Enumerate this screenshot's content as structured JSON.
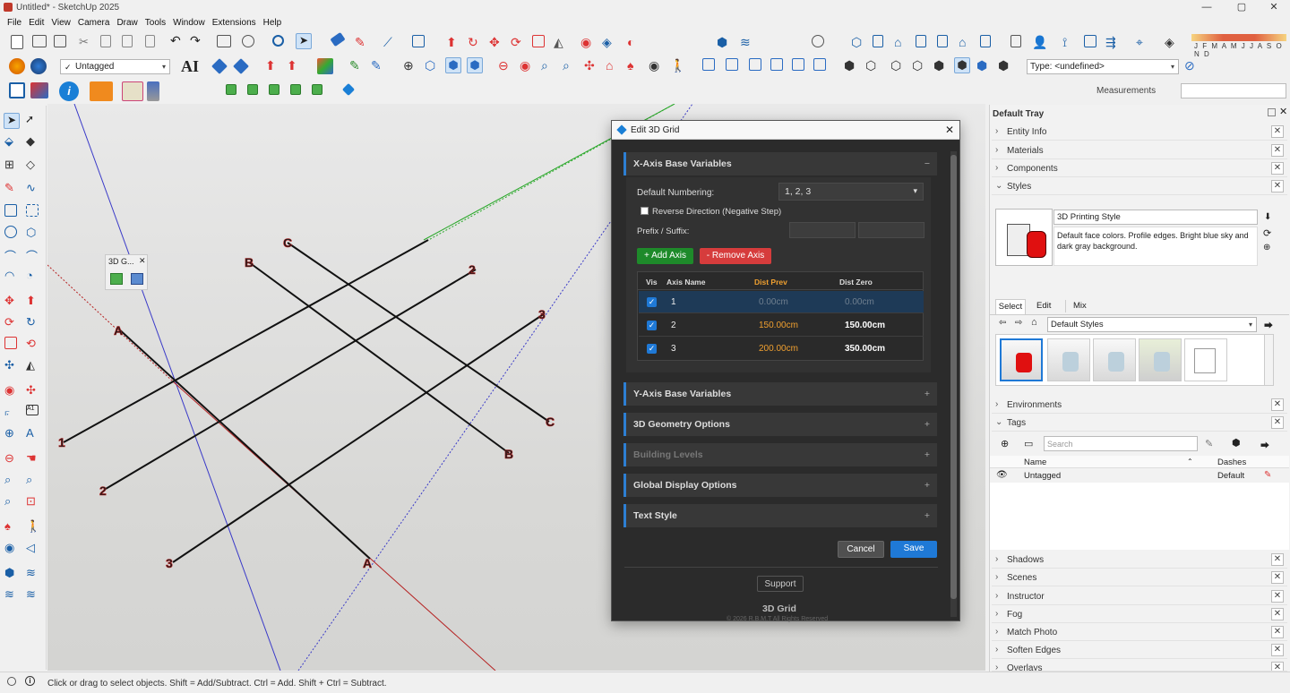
{
  "window": {
    "title": "Untitled* - SketchUp 2025",
    "minimize": "—",
    "maximize": "▢",
    "close": "✕"
  },
  "menu": [
    "File",
    "Edit",
    "View",
    "Camera",
    "Draw",
    "Tools",
    "Window",
    "Extensions",
    "Help"
  ],
  "timeline": {
    "months": "J F M A M J J A S O N D"
  },
  "toolbar": {
    "tag_select": "Untagged",
    "ai_label": "AI",
    "type_select": "Type: <undefined>",
    "measurements_label": "Measurements"
  },
  "floating_panel": {
    "title": "3D G...",
    "close": "✕"
  },
  "axes": {
    "x_labels": [
      "A",
      "B",
      "C"
    ],
    "y_labels": [
      "1",
      "2",
      "3"
    ]
  },
  "dialog": {
    "title": "Edit 3D Grid",
    "close": "✕",
    "x_section": "X-Axis Base Variables",
    "x_toggle": "−",
    "numbering_label": "Default Numbering:",
    "numbering_value": "1, 2, 3",
    "reverse_label": "Reverse Direction (Negative Step)",
    "prefix_label": "Prefix / Suffix:",
    "add_axis": "+ Add Axis",
    "remove_axis": "- Remove Axis",
    "table": {
      "headers": [
        "Vis",
        "Axis Name",
        "Dist Prev",
        "Dist Zero"
      ],
      "rows": [
        {
          "name": "1",
          "prev": "0.00cm",
          "zero": "0.00cm"
        },
        {
          "name": "2",
          "prev": "150.00cm",
          "zero": "150.00cm"
        },
        {
          "name": "3",
          "prev": "200.00cm",
          "zero": "350.00cm"
        }
      ]
    },
    "sections": [
      "Y-Axis Base Variables",
      "3D Geometry Options",
      "Building Levels",
      "Global Display Options",
      "Text Style"
    ],
    "plus": "+",
    "cancel": "Cancel",
    "save": "Save",
    "support": "Support",
    "footer_title": "3D Grid",
    "footer_copy": "© 2026 R.B.M.T All Rights Reserved"
  },
  "tray": {
    "title": "Default Tray",
    "panels_top": [
      "Entity Info",
      "Materials",
      "Components",
      "Styles"
    ],
    "style_name": "3D Printing Style",
    "style_desc": "Default face colors. Profile edges. Bright blue sky and dark gray background.",
    "style_tabs": [
      "Select",
      "Edit",
      "Mix"
    ],
    "style_collection": "Default Styles",
    "panels_mid": [
      "Environments",
      "Tags"
    ],
    "tags_search": "Search",
    "tags_headers": [
      "Name",
      "Dashes"
    ],
    "tags_row": {
      "name": "Untagged",
      "dashes": "Default"
    },
    "panels_bottom": [
      "Shadows",
      "Scenes",
      "Instructor",
      "Fog",
      "Match Photo",
      "Soften Edges",
      "Overlays"
    ]
  },
  "status": {
    "text": "Click or drag to select objects. Shift = Add/Subtract. Ctrl = Add. Shift + Ctrl = Subtract."
  },
  "colors": {
    "accent": "#1f79d6",
    "add_green": "#1e8a2a",
    "remove_red": "#d63c3c",
    "orange": "#f0a030",
    "dialog_bg": "#2b2b2b"
  }
}
